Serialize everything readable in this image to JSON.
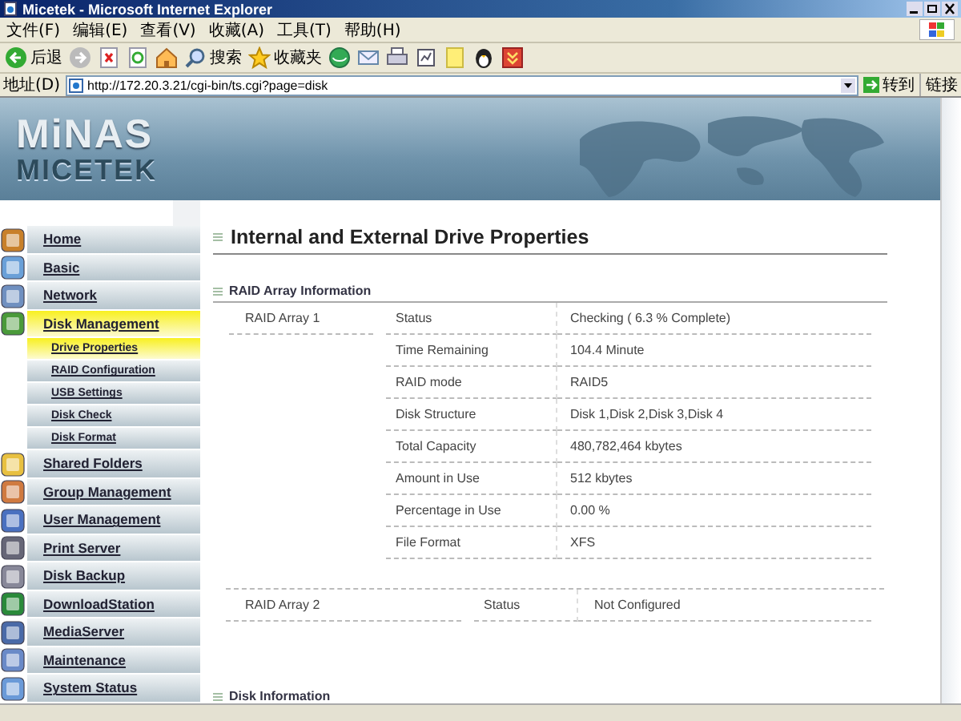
{
  "window": {
    "title": "Micetek - Microsoft Internet Explorer"
  },
  "menu_bar": [
    "文件(F)",
    "编辑(E)",
    "查看(V)",
    "收藏(A)",
    "工具(T)",
    "帮助(H)"
  ],
  "toolbar": [
    {
      "kind": "back",
      "label": "后退"
    },
    {
      "kind": "forward"
    },
    {
      "kind": "stop"
    },
    {
      "kind": "refresh"
    },
    {
      "kind": "home"
    },
    {
      "kind": "search",
      "label": "搜索"
    },
    {
      "kind": "favorites",
      "label": "收藏夹"
    },
    {
      "kind": "media"
    },
    {
      "kind": "mail"
    },
    {
      "kind": "print"
    },
    {
      "kind": "edit"
    },
    {
      "kind": "note"
    },
    {
      "kind": "penguin"
    },
    {
      "kind": "download"
    }
  ],
  "address_bar": {
    "label": "地址(D)",
    "value": "http://172.20.3.21/cgi-bin/ts.cgi?page=disk",
    "go": "转到",
    "links": "链接"
  },
  "banner": {
    "logo_top": "MiNAS",
    "logo_bottom": "MICETEK"
  },
  "sidebar": {
    "items": [
      {
        "kind": "main",
        "label": "Home",
        "selected": false
      },
      {
        "kind": "main",
        "label": "Basic",
        "selected": false
      },
      {
        "kind": "main",
        "label": "Network",
        "selected": false
      },
      {
        "kind": "main",
        "label": "Disk Management",
        "selected": true
      },
      {
        "kind": "sub",
        "label": "Drive Properties",
        "selected": true
      },
      {
        "kind": "sub",
        "label": "RAID Configuration",
        "selected": false
      },
      {
        "kind": "sub",
        "label": "USB Settings",
        "selected": false
      },
      {
        "kind": "sub",
        "label": "Disk Check",
        "selected": false
      },
      {
        "kind": "sub",
        "label": "Disk Format",
        "selected": false
      },
      {
        "kind": "main",
        "label": "Shared Folders",
        "selected": false
      },
      {
        "kind": "main",
        "label": "Group Management",
        "selected": false
      },
      {
        "kind": "main",
        "label": "User Management",
        "selected": false
      },
      {
        "kind": "main",
        "label": "Print Server",
        "selected": false
      },
      {
        "kind": "main",
        "label": "Disk Backup",
        "selected": false
      },
      {
        "kind": "main",
        "label": "DownloadStation",
        "selected": false
      },
      {
        "kind": "main",
        "label": "MediaServer",
        "selected": false
      },
      {
        "kind": "main",
        "label": "Maintenance",
        "selected": false
      },
      {
        "kind": "main",
        "label": "System Status",
        "selected": false
      }
    ]
  },
  "content": {
    "title": "Internal and External Drive Properties",
    "raid_section": {
      "title": "RAID Array Information",
      "array_1": {
        "name": "RAID Array 1",
        "rows": [
          {
            "label": "Status",
            "value": "Checking ( 6.3 % Complete)"
          },
          {
            "label": "Time Remaining",
            "value": "104.4 Minute"
          },
          {
            "label": "RAID mode",
            "value": "RAID5"
          },
          {
            "label": "Disk Structure",
            "value": "Disk 1,Disk 2,Disk 3,Disk 4"
          },
          {
            "label": "Total Capacity",
            "value": "480,782,464 kbytes"
          },
          {
            "label": "Amount in Use",
            "value": "512 kbytes"
          },
          {
            "label": "Percentage in Use",
            "value": "0.00 %"
          },
          {
            "label": "File Format",
            "value": "XFS"
          }
        ]
      },
      "array_2": {
        "name": "RAID Array 2",
        "status_label": "Status",
        "status_value": "Not Configured"
      }
    },
    "disk_section": {
      "title": "Disk Information"
    }
  }
}
